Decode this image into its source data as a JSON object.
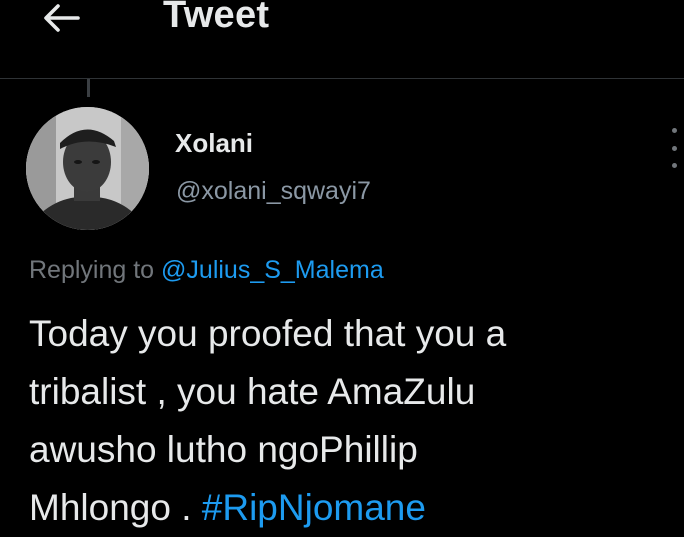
{
  "header": {
    "title": "Tweet",
    "back_icon": "arrow-left-icon"
  },
  "tweet": {
    "author": {
      "name": "Xolani",
      "handle": "@xolani_sqwayi7"
    },
    "replying_prefix": "Replying to",
    "replying_to": "@Julius_S_Malema",
    "text_lines": [
      "Today you proofed that you a",
      "tribalist , you hate AmaZulu",
      "awusho lutho ngoPhillip",
      "Mhlongo ."
    ],
    "hashtag": "#RipNjomane"
  },
  "colors": {
    "background": "#000000",
    "text": "#e7e9ea",
    "secondary": "#71767b",
    "link": "#1d9bf0",
    "divider": "#2f3336"
  }
}
